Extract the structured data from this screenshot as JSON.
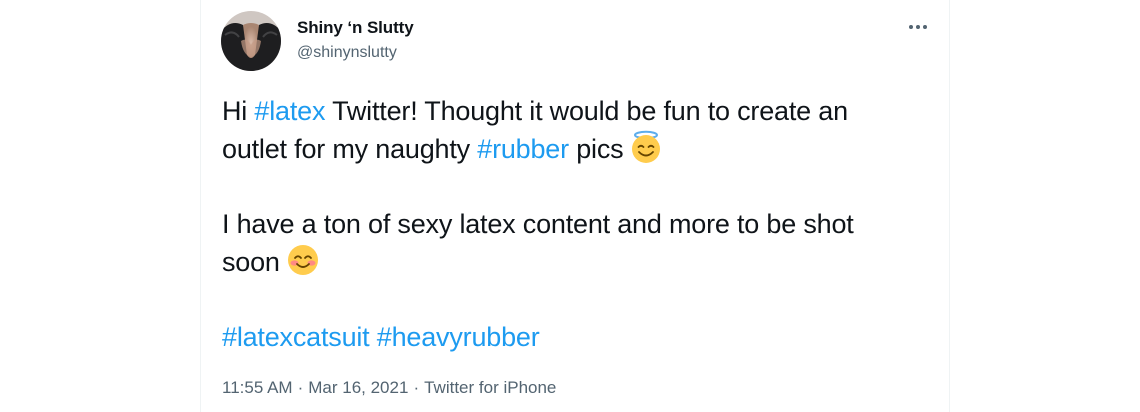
{
  "author": {
    "display_name": "Shiny ‘n Slutty",
    "handle": "@shinynslutty"
  },
  "tweet": {
    "line1": {
      "pre": "Hi ",
      "tag": "#latex",
      "post": " Twitter! Thought it would be fun to create an"
    },
    "line2": {
      "pre": "outlet for my naughty ",
      "tag": "#rubber",
      "post": " pics",
      "emoji_icon": "smiling-face-with-halo-icon"
    },
    "line3": {
      "text": "I have a ton of sexy latex content and more to be shot"
    },
    "line4": {
      "text": "soon",
      "emoji_icon": "smiling-face-with-smiling-eyes-icon"
    },
    "hashtags": [
      "#latexcatsuit",
      "#heavyrubber"
    ]
  },
  "meta": {
    "time": "11:55 AM",
    "date": "Mar 16, 2021",
    "source": "Twitter for iPhone",
    "separator": "·"
  },
  "colors": {
    "hashtag": "#1d9bf0",
    "text": "#0f1419",
    "secondary": "#536471",
    "border": "#eff3f4"
  }
}
